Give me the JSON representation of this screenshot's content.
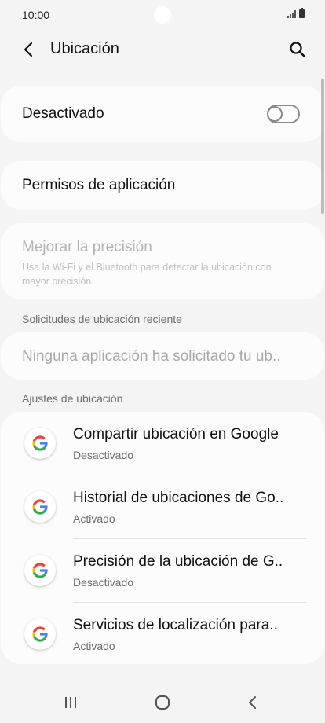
{
  "status_bar": {
    "time": "10:00",
    "icons": [
      "signal-icon",
      "battery-icon"
    ]
  },
  "header": {
    "title": "Ubicación",
    "back_icon": "back-arrow-icon",
    "search_icon": "search-icon"
  },
  "location_toggle": {
    "label": "Desactivado",
    "state": "off"
  },
  "app_permissions": {
    "label": "Permisos de aplicación"
  },
  "improve_accuracy": {
    "title": "Mejorar la precisión",
    "description": "Usa la Wi-Fi y el Bluetooth para detectar la ubicación con mayor precisión."
  },
  "recent_requests": {
    "header": "Solicitudes de ubicación reciente",
    "empty_text": "Ninguna aplicación ha solicitado tu ub.."
  },
  "location_settings": {
    "header": "Ajustes de ubicación",
    "items": [
      {
        "title": "Compartir ubicación en Google",
        "status": "Desactivado",
        "icon": "google-icon"
      },
      {
        "title": "Historial de ubicaciones de Go..",
        "status": "Activado",
        "icon": "google-icon"
      },
      {
        "title": "Precisión de la ubicación de G..",
        "status": "Desactivado",
        "icon": "google-icon"
      },
      {
        "title": "Servicios de localización para..",
        "status": "Activado",
        "icon": "google-icon"
      }
    ]
  },
  "nav_bar": {
    "buttons": [
      "recents-icon",
      "home-icon",
      "back-icon"
    ]
  },
  "colors": {
    "background": "#f4f4f4",
    "card": "#fcfcfc",
    "secondary_text": "#6e6e6e",
    "disabled_text": "#b3b3b3",
    "google_blue": "#4285F4",
    "google_red": "#EA4335",
    "google_yellow": "#FBBC05",
    "google_green": "#34A853"
  }
}
